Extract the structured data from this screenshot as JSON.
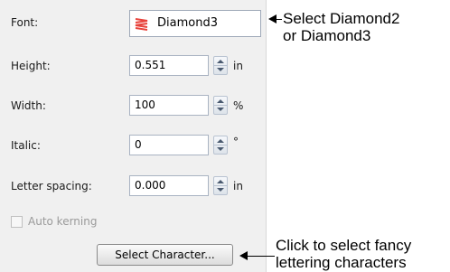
{
  "panel": {
    "font_label": "Font:",
    "font_value": "Diamond3",
    "font_icon": "lettering-font-icon",
    "height_label": "Height:",
    "height_value": "0.551",
    "height_unit": "in",
    "width_label": "Width:",
    "width_value": "100",
    "width_unit": "%",
    "italic_label": "Italic:",
    "italic_value": "0",
    "italic_unit": "°",
    "spacing_label": "Letter spacing:",
    "spacing_value": "0.000",
    "spacing_unit": "in",
    "auto_kerning_label": "Auto kerning",
    "auto_kerning_checked": false,
    "select_button_label": "Select Character..."
  },
  "callouts": {
    "font_line1": "Select Diamond2",
    "font_line2": "or Diamond3",
    "button_line1": "Click to select fancy",
    "button_line2": "lettering characters"
  },
  "colors": {
    "panel_bg": "#f0f0f0",
    "font_icon": "#e8413a"
  }
}
